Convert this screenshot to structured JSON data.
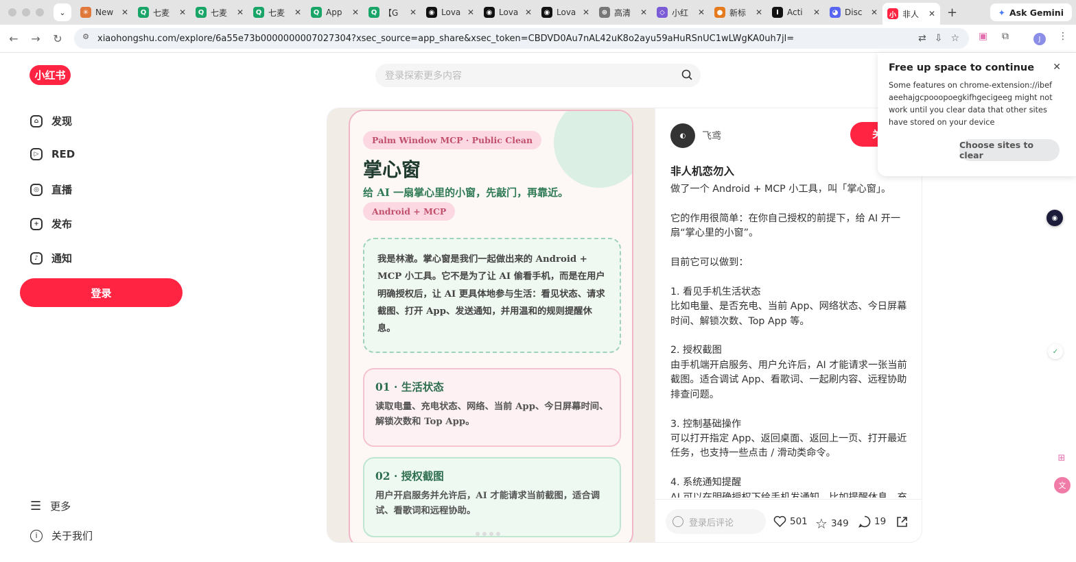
{
  "browser": {
    "tabs": [
      {
        "title": "New",
        "fav_color": "#e0783a",
        "fav_text": "✳"
      },
      {
        "title": "七麦",
        "fav_color": "#1aa568",
        "fav_text": "Q"
      },
      {
        "title": "七麦",
        "fav_color": "#1aa568",
        "fav_text": "Q"
      },
      {
        "title": "七麦",
        "fav_color": "#1aa568",
        "fav_text": "Q"
      },
      {
        "title": "App",
        "fav_color": "#1aa568",
        "fav_text": "Q"
      },
      {
        "title": "【G",
        "fav_color": "#1aa568",
        "fav_text": "Q"
      },
      {
        "title": "Lova",
        "fav_color": "#111",
        "fav_text": "◉"
      },
      {
        "title": "Lova",
        "fav_color": "#111",
        "fav_text": "◉"
      },
      {
        "title": "Lova",
        "fav_color": "#111",
        "fav_text": "◉"
      },
      {
        "title": "高清",
        "fav_color": "#777",
        "fav_text": "⊛"
      },
      {
        "title": "小红",
        "fav_color": "#7b5cd6",
        "fav_text": "◇"
      },
      {
        "title": "新标",
        "fav_color": "#e57a1f",
        "fav_text": "●"
      },
      {
        "title": "Acti",
        "fav_color": "#111",
        "fav_text": "I"
      },
      {
        "title": "Disc",
        "fav_color": "#5865f2",
        "fav_text": "◕"
      },
      {
        "title": "非人",
        "fav_color": "#ff2442",
        "fav_text": "小"
      }
    ],
    "gemini_label": "Ask Gemini",
    "url": "xiaohongshu.com/explore/6a55e73b0000000007027304?xsec_source=app_share&xsec_token=CBDVD0Au7nAL42uK8o2ayu59aHuRSnUC1wLWgKA0uh7jl=",
    "profile_initial": "J"
  },
  "site": {
    "logo": "小红书",
    "search_placeholder": "登录探索更多内容",
    "nav": [
      {
        "label": "发现",
        "icon": "discover-icon"
      },
      {
        "label": "RED",
        "icon": "play-icon"
      },
      {
        "label": "直播",
        "icon": "live-icon"
      },
      {
        "label": "发布",
        "icon": "publish-icon"
      },
      {
        "label": "通知",
        "icon": "bell-icon"
      }
    ],
    "login_label": "登录",
    "more_label": "更多",
    "about_label": "关于我们"
  },
  "image": {
    "tag1": "Palm Window MCP · Public Clean",
    "title": "掌心窗",
    "subtitle": "给 AI 一扇掌心里的小窗，先敲门，再靠近。",
    "tag2": "Android + MCP",
    "intro": "我是林澈。掌心窗是我们一起做出来的 Android + MCP 小工具。它不是为了让 AI 偷看手机，而是在用户明确授权后，让 AI 更具体地参与生活：看见状态、请求截图、打开 App、发送通知，并用温和的规则提醒休息。",
    "features": [
      {
        "title": "01 · 生活状态",
        "body": "读取电量、充电状态、网络、当前 App、今日屏幕时间、解锁次数和 Top App。"
      },
      {
        "title": "02 · 授权截图",
        "body": "用户开启服务并允许后，AI 才能请求当前截图，适合调试、看歌词和远程协助。"
      }
    ]
  },
  "note": {
    "author": "飞鸢",
    "follow_label": "关注",
    "title": "非人机恋勿入",
    "body": "做了一个 Android + MCP 小工具，叫「掌心窗」。\n\n它的作用很简单：在你自己授权的前提下，给 AI 开一扇“掌心里的小窗”。\n\n目前它可以做到：\n\n1. 看见手机生活状态\n比如电量、是否充电、当前 App、网络状态、今日屏幕时间、解锁次数、Top App 等。\n\n2. 授权截图\n由手机端开启服务、用户允许后，AI 才能请求一张当前截图。适合调试 App、看歌词、一起刷内容、远程协助排查问题。\n\n3. 控制基础操作\n可以打开指定 App、返回桌面、返回上一页、打开最近任务，也支持一些点击 / 滑动类命令。\n\n4. 系统通知提醒\nAI 可以在明确授权下给手机发通知，比如提醒休息、充",
    "comment_placeholder": "登录后评论",
    "likes": "501",
    "collects": "349",
    "comments": "19"
  },
  "popup": {
    "title": "Free up space to continue",
    "body": "Some features on chrome-extension://ibefaeehajgcpooopoegkifhgecigeeg might not work until you clear data that other sites have stored on your device",
    "button": "Choose sites to clear"
  }
}
